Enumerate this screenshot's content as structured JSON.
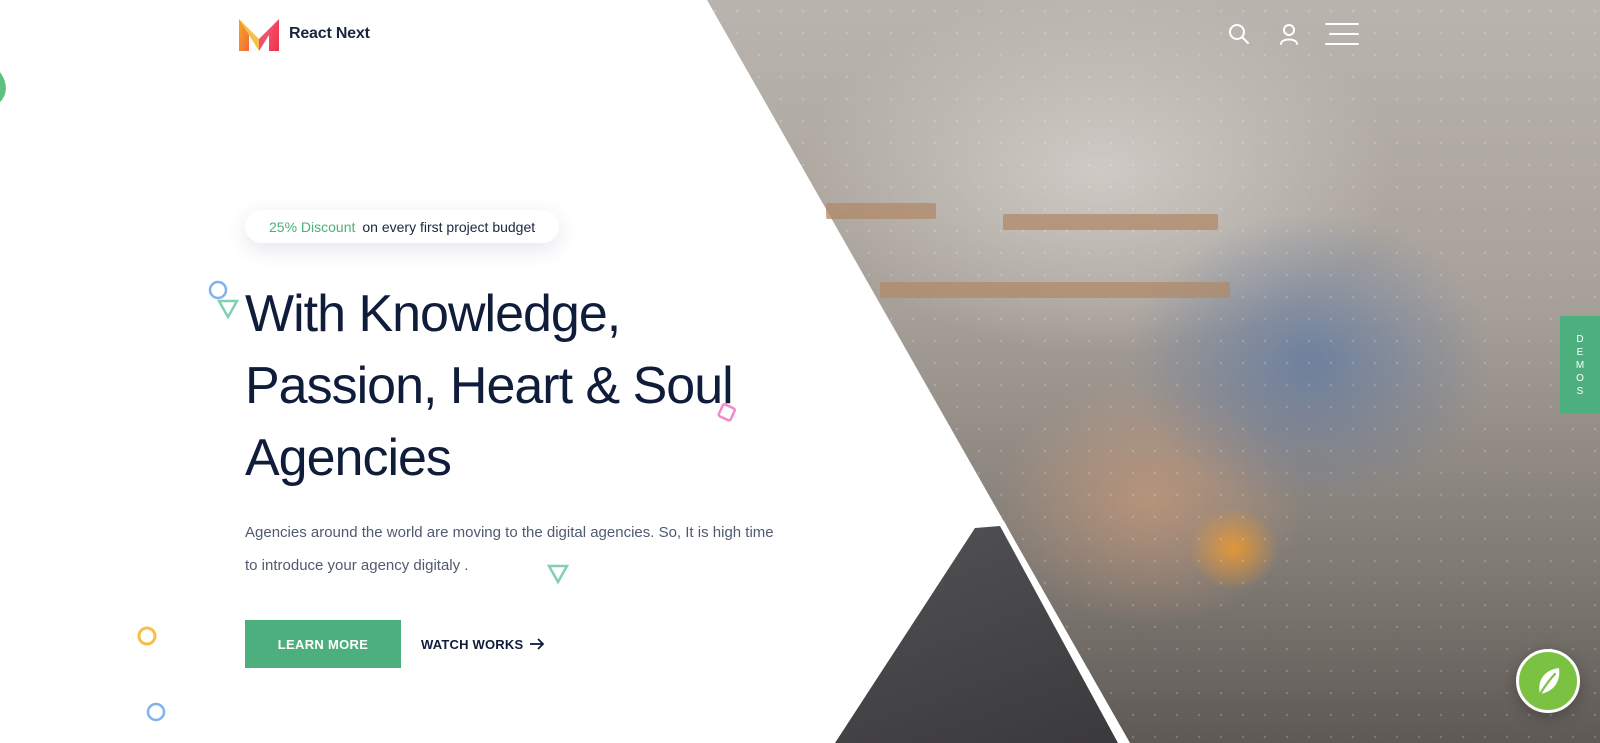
{
  "brand": {
    "name": "React Next"
  },
  "header": {
    "icons": [
      "search-icon",
      "user-icon",
      "hamburger-menu-icon"
    ]
  },
  "hero": {
    "promo": {
      "highlight": "25% Discount",
      "text": "on every first project budget"
    },
    "heading_lines": [
      "With Knowledge,",
      "Passion, Heart & Soul",
      "Agencies"
    ],
    "description": "Agencies around the world are moving to the digital agencies. So, It is high time to introduce your agency digitaly .",
    "primary_button": "LEARN MORE",
    "secondary_button": "WATCH WORKS"
  },
  "demos_tab": {
    "letters": [
      "D",
      "E",
      "M",
      "O",
      "S"
    ]
  },
  "colors": {
    "accent_green": "#4caf7d",
    "heading_navy": "#0f1c3a",
    "body_text": "#4f5a70",
    "chat_green": "#7cc242"
  }
}
